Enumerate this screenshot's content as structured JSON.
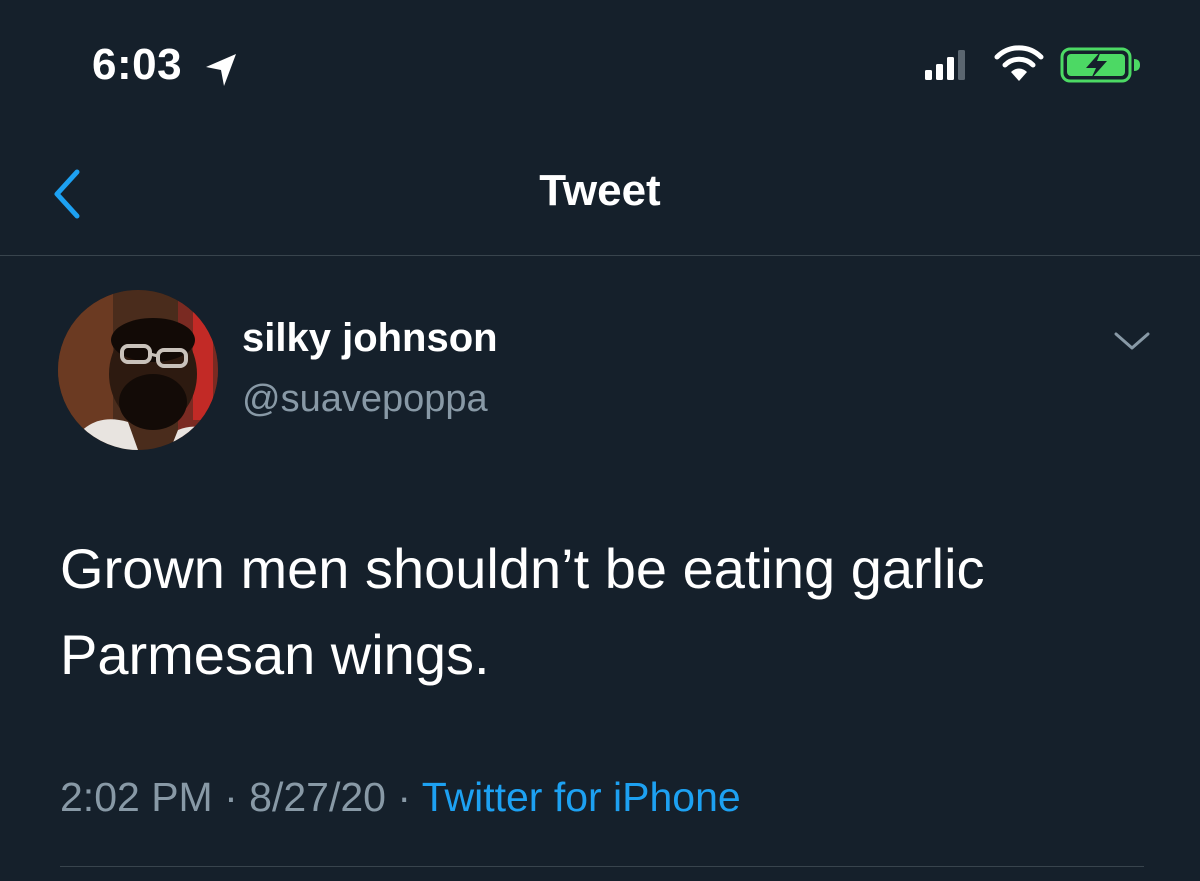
{
  "status_bar": {
    "time": "6:03"
  },
  "nav": {
    "title": "Tweet"
  },
  "tweet": {
    "display_name": "silky johnson",
    "handle": "@suavepoppa",
    "text": "Grown men shouldn’t be eating garlic Parmesan wings.",
    "time": "2:02 PM",
    "separator": "·",
    "date": "8/27/20",
    "source": "Twitter for iPhone"
  },
  "colors": {
    "background": "#15202b",
    "accent": "#1da1f2",
    "secondary_text": "#8899a6",
    "battery": "#4cd964"
  }
}
